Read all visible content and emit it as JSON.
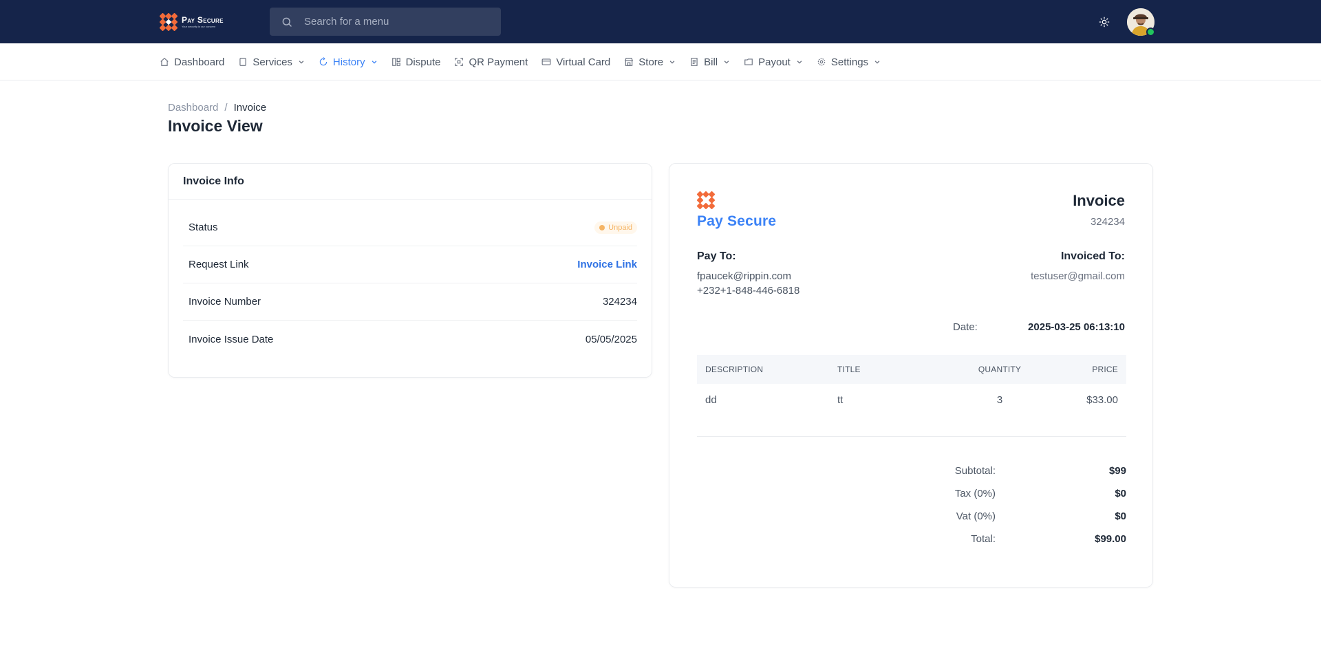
{
  "header": {
    "brand_name": "Pay Secure",
    "brand_tagline": "Your security is our concern",
    "search_placeholder": "Search for a menu"
  },
  "nav": {
    "items": [
      {
        "label": "Dashboard",
        "icon": "home-icon",
        "dropdown": false,
        "active": false
      },
      {
        "label": "Services",
        "icon": "file-icon",
        "dropdown": true,
        "active": false
      },
      {
        "label": "History",
        "icon": "history-icon",
        "dropdown": true,
        "active": true
      },
      {
        "label": "Dispute",
        "icon": "columns-icon",
        "dropdown": false,
        "active": false
      },
      {
        "label": "QR Payment",
        "icon": "qr-icon",
        "dropdown": false,
        "active": false
      },
      {
        "label": "Virtual Card",
        "icon": "card-icon",
        "dropdown": false,
        "active": false
      },
      {
        "label": "Store",
        "icon": "store-icon",
        "dropdown": true,
        "active": false
      },
      {
        "label": "Bill",
        "icon": "receipt-icon",
        "dropdown": true,
        "active": false
      },
      {
        "label": "Payout",
        "icon": "wallet-icon",
        "dropdown": true,
        "active": false
      },
      {
        "label": "Settings",
        "icon": "gear-icon",
        "dropdown": true,
        "active": false
      }
    ],
    "active_color": "#3b82f6"
  },
  "breadcrumb": {
    "parent": "Dashboard",
    "separator": "/",
    "current": "Invoice"
  },
  "page": {
    "title": "Invoice View"
  },
  "invoice_info": {
    "title": "Invoice Info",
    "rows": {
      "status": {
        "label": "Status",
        "value": "Unpaid"
      },
      "request_link": {
        "label": "Request Link",
        "value": "Invoice Link"
      },
      "invoice_number": {
        "label": "Invoice Number",
        "value": "324234"
      },
      "issue_date": {
        "label": "Invoice Issue Date",
        "value": "05/05/2025"
      }
    }
  },
  "invoice": {
    "brand": "Pay Secure",
    "title": "Invoice",
    "number": "324234",
    "pay_to": {
      "label": "Pay To:",
      "email": "fpaucek@rippin.com",
      "phone": "+232+1-848-446-6818"
    },
    "invoiced_to": {
      "label": "Invoiced To:",
      "email": "testuser@gmail.com"
    },
    "date": {
      "label": "Date:",
      "value": "2025-03-25 06:13:10"
    },
    "table": {
      "columns": {
        "description": "DESCRIPTION",
        "title": "TITLE",
        "quantity": "QUANTITY",
        "price": "PRICE"
      },
      "rows": [
        {
          "description": "dd",
          "title": "tt",
          "quantity": "3",
          "price": "$33.00"
        }
      ]
    },
    "totals": {
      "subtotal": {
        "label": "Subtotal:",
        "value": "$99"
      },
      "tax": {
        "label": "Tax (0%)",
        "value": "$0"
      },
      "vat": {
        "label": "Vat (0%)",
        "value": "$0"
      },
      "total": {
        "label": "Total:",
        "value": "$99.00"
      }
    }
  },
  "colors": {
    "header_bg": "#15244a",
    "brand_blue": "#3b82f6",
    "logo_orange": "#f26b3a",
    "status_unpaid": "#f5b464"
  }
}
